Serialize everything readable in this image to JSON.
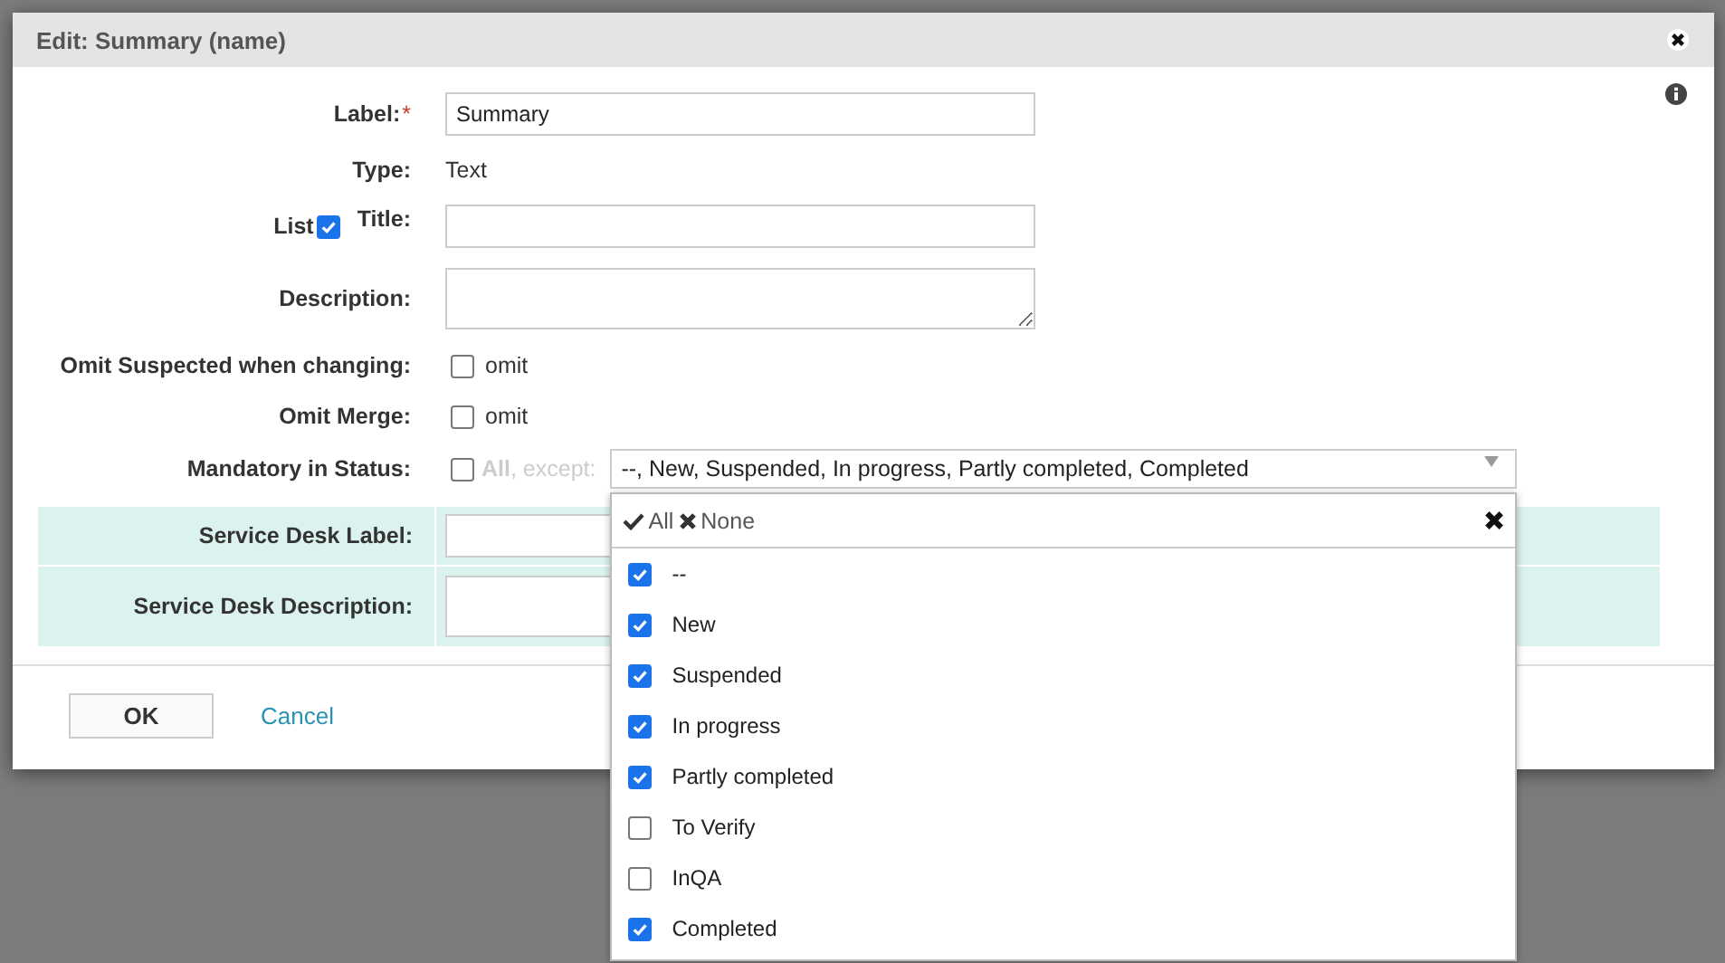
{
  "dialog": {
    "title": "Edit: Summary (name)"
  },
  "form": {
    "label_field": {
      "label": "Label:",
      "required_mark": "*",
      "value": "Summary"
    },
    "type_field": {
      "label": "Type:",
      "value": "Text"
    },
    "title_field": {
      "list_label": "List",
      "list_checked": true,
      "label": "Title:"
    },
    "description_field": {
      "label": "Description:"
    },
    "omit_suspected": {
      "label": "Omit Suspected when changing:",
      "option": "omit",
      "checked": false
    },
    "omit_merge": {
      "label": "Omit Merge:",
      "option": "omit",
      "checked": false
    },
    "mandatory": {
      "label": "Mandatory in Status:",
      "all_checked": false,
      "all_label": "All",
      "except_label": ", except:",
      "selected_text": "--, New, Suspended, In progress, Partly completed, Completed"
    },
    "service_desk": [
      {
        "label": "Service Desk Label:",
        "kind": "input"
      },
      {
        "label": "Service Desk Description:",
        "kind": "textarea"
      }
    ]
  },
  "buttons": {
    "ok": "OK",
    "cancel": "Cancel"
  },
  "status_dropdown": {
    "select_all": "All",
    "select_none": "None",
    "options": [
      {
        "label": "--",
        "checked": true
      },
      {
        "label": "New",
        "checked": true
      },
      {
        "label": "Suspended",
        "checked": true
      },
      {
        "label": "In progress",
        "checked": true
      },
      {
        "label": "Partly completed",
        "checked": true
      },
      {
        "label": "To Verify",
        "checked": false
      },
      {
        "label": "InQA",
        "checked": false
      },
      {
        "label": "Completed",
        "checked": true
      }
    ]
  }
}
